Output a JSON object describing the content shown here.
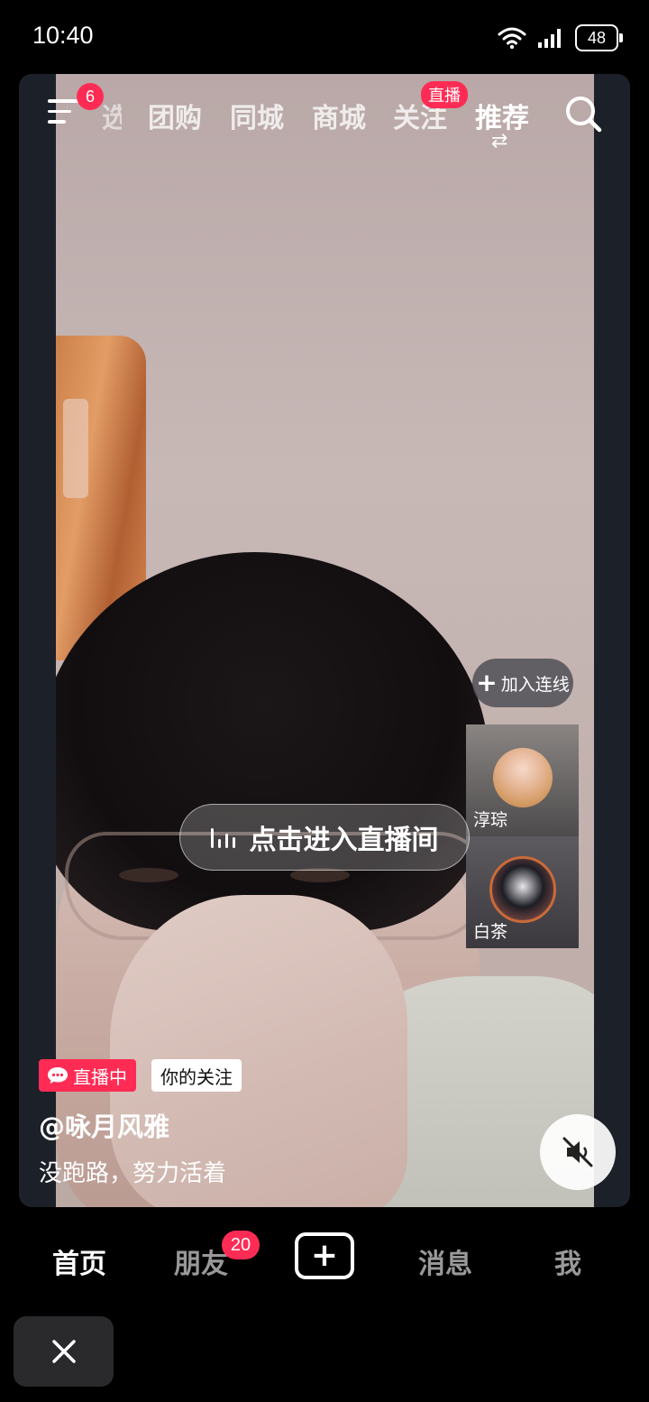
{
  "status_bar": {
    "time": "10:40",
    "battery": "48"
  },
  "top_nav": {
    "menu_badge": "6",
    "partial_tab": "选",
    "tabs": [
      {
        "label": "团购"
      },
      {
        "label": "同城"
      },
      {
        "label": "商城"
      },
      {
        "label": "关注"
      },
      {
        "label": "推荐"
      }
    ],
    "active_tab": "推荐",
    "live_badge": "直播"
  },
  "live": {
    "join_label": "加入连线",
    "enter_label": "点击进入直播间",
    "guests": [
      {
        "name": "淳琮"
      },
      {
        "name": "白茶"
      }
    ],
    "live_tag": "直播中",
    "follow_tag": "你的关注",
    "username": "@咏月风雅",
    "caption": "没跑路，努力活着"
  },
  "bottom_tabs": {
    "home": "首页",
    "friends": "朋友",
    "friends_badge": "20",
    "messages": "消息",
    "me": "我"
  },
  "colors": {
    "accent": "#fe2c55",
    "card_bg": "#1c2129"
  }
}
